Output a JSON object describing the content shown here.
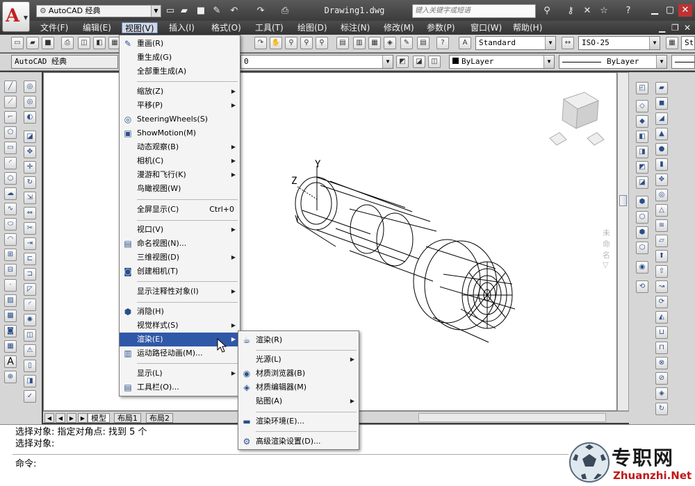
{
  "title_bar": {
    "workspace": "AutoCAD 经典",
    "document": "Drawing1.dwg",
    "search_placeholder": "键入关键字或短语"
  },
  "menubar": [
    {
      "label": "文件(F)"
    },
    {
      "label": "编辑(E)"
    },
    {
      "label": "视图(V)"
    },
    {
      "label": "插入(I)"
    },
    {
      "label": "格式(O)"
    },
    {
      "label": "工具(T)"
    },
    {
      "label": "绘图(D)"
    },
    {
      "label": "标注(N)"
    },
    {
      "label": "修改(M)"
    },
    {
      "label": "参数(P)"
    },
    {
      "label": "窗口(W)"
    },
    {
      "label": "帮助(H)"
    }
  ],
  "toolbar": {
    "text_style": "Standard",
    "dim_style": "ISO-25",
    "table_style_partial": "St",
    "workspace_combo": "AutoCAD 经典",
    "layer": "0",
    "color": "ByLayer",
    "linetype": "ByLayer"
  },
  "view_menu": {
    "items": [
      {
        "label": "重画(R)",
        "icon": "pencil-icon"
      },
      {
        "label": "重生成(G)"
      },
      {
        "label": "全部重生成(A)"
      },
      {
        "label": "缩放(Z)",
        "submenu": true
      },
      {
        "label": "平移(P)",
        "submenu": true
      },
      {
        "label": "SteeringWheels(S)",
        "icon": "steering-wheel-icon"
      },
      {
        "label": "ShowMotion(M)",
        "icon": "showmotion-icon"
      },
      {
        "label": "动态观察(B)",
        "submenu": true
      },
      {
        "label": "相机(C)",
        "submenu": true
      },
      {
        "label": "漫游和飞行(K)",
        "submenu": true
      },
      {
        "label": "鸟瞰视图(W)"
      },
      {
        "label": "全屏显示(C)",
        "shortcut": "Ctrl+0"
      },
      {
        "label": "视口(V)",
        "submenu": true
      },
      {
        "label": "命名视图(N)...",
        "icon": "named-view-icon"
      },
      {
        "label": "三维视图(D)",
        "submenu": true
      },
      {
        "label": "创建相机(T)",
        "icon": "camera-icon"
      },
      {
        "label": "显示注释性对象(I)",
        "submenu": true
      },
      {
        "label": "消隐(H)",
        "icon": "hide-icon"
      },
      {
        "label": "视觉样式(S)",
        "submenu": true
      },
      {
        "label": "渲染(E)",
        "submenu": true,
        "highlighted": true
      },
      {
        "label": "运动路径动画(M)...",
        "icon": "motion-path-icon"
      },
      {
        "label": "显示(L)",
        "submenu": true
      },
      {
        "label": "工具栏(O)...",
        "icon": "toolbar-icon"
      }
    ]
  },
  "render_submenu": {
    "items": [
      {
        "label": "渲染(R)",
        "icon": "teapot-icon"
      },
      {
        "label": "光源(L)",
        "submenu": true
      },
      {
        "label": "材质浏览器(B)",
        "icon": "material-browser-icon"
      },
      {
        "label": "材质编辑器(M)",
        "icon": "material-editor-icon"
      },
      {
        "label": "贴图(A)",
        "submenu": true
      },
      {
        "label": "渲染环境(E)...",
        "icon": "render-environment-icon"
      },
      {
        "label": "高级渲染设置(D)...",
        "icon": "advanced-render-icon"
      }
    ]
  },
  "viewcube": {
    "label": "未命名"
  },
  "axes": {
    "y": "Y",
    "z": "Z"
  },
  "tabs": [
    {
      "label": "模型",
      "active": true
    },
    {
      "label": "布局1"
    },
    {
      "label": "布局2"
    }
  ],
  "command": {
    "line1": "选择对象: 指定对角点: 找到 5 个",
    "line2": "选择对象:",
    "prompt": "命令:"
  },
  "watermark": {
    "cn": "专职网",
    "en": "Zhuanzhi.Net"
  }
}
